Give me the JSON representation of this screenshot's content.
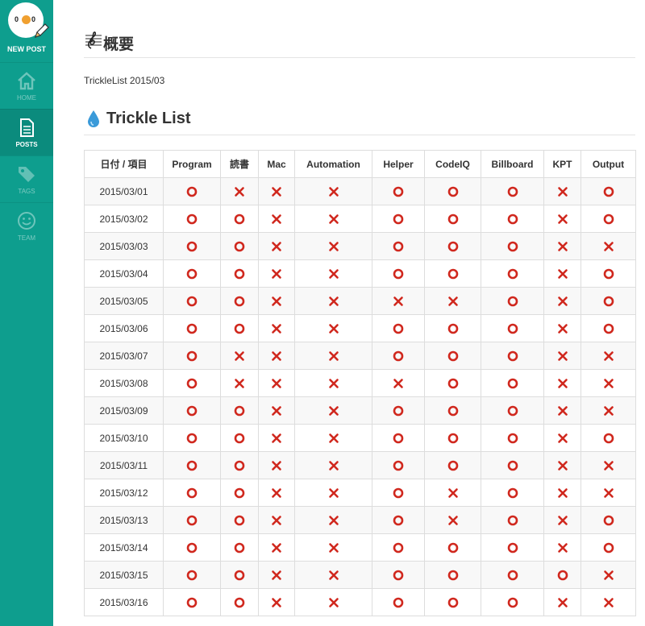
{
  "sidebar": {
    "new_post": "NEW POST",
    "items": [
      {
        "label": "HOME",
        "icon": "home-icon",
        "active": false
      },
      {
        "label": "POSTS",
        "icon": "document-icon",
        "active": true
      },
      {
        "label": "TAGS",
        "icon": "tag-icon",
        "active": false
      },
      {
        "label": "TEAM",
        "icon": "smiley-icon",
        "active": false
      }
    ],
    "avatar_eyes": [
      "0",
      "0"
    ]
  },
  "colors": {
    "sidebar_bg": "#0e9e8e",
    "sidebar_active": "#0b8b7d",
    "mark_red": "#d0281e",
    "drop_blue": "#3a9ad9"
  },
  "overview": {
    "heading": "概要",
    "subtitle": "TrickleList 2015/03"
  },
  "trickle": {
    "heading": "Trickle List",
    "columns": [
      "日付 / 項目",
      "Program",
      "読書",
      "Mac",
      "Automation",
      "Helper",
      "CodeIQ",
      "Billboard",
      "KPT",
      "Output"
    ],
    "rows": [
      {
        "date": "2015/03/01",
        "marks": [
          "o",
          "x",
          "x",
          "x",
          "o",
          "o",
          "o",
          "x",
          "o"
        ]
      },
      {
        "date": "2015/03/02",
        "marks": [
          "o",
          "o",
          "x",
          "x",
          "o",
          "o",
          "o",
          "x",
          "o"
        ]
      },
      {
        "date": "2015/03/03",
        "marks": [
          "o",
          "o",
          "x",
          "x",
          "o",
          "o",
          "o",
          "x",
          "x"
        ]
      },
      {
        "date": "2015/03/04",
        "marks": [
          "o",
          "o",
          "x",
          "x",
          "o",
          "o",
          "o",
          "x",
          "o"
        ]
      },
      {
        "date": "2015/03/05",
        "marks": [
          "o",
          "o",
          "x",
          "x",
          "x",
          "x",
          "o",
          "x",
          "o"
        ]
      },
      {
        "date": "2015/03/06",
        "marks": [
          "o",
          "o",
          "x",
          "x",
          "o",
          "o",
          "o",
          "x",
          "o"
        ]
      },
      {
        "date": "2015/03/07",
        "marks": [
          "o",
          "x",
          "x",
          "x",
          "o",
          "o",
          "o",
          "x",
          "x"
        ]
      },
      {
        "date": "2015/03/08",
        "marks": [
          "o",
          "x",
          "x",
          "x",
          "x",
          "o",
          "o",
          "x",
          "x"
        ]
      },
      {
        "date": "2015/03/09",
        "marks": [
          "o",
          "o",
          "x",
          "x",
          "o",
          "o",
          "o",
          "x",
          "x"
        ]
      },
      {
        "date": "2015/03/10",
        "marks": [
          "o",
          "o",
          "x",
          "x",
          "o",
          "o",
          "o",
          "x",
          "o"
        ]
      },
      {
        "date": "2015/03/11",
        "marks": [
          "o",
          "o",
          "x",
          "x",
          "o",
          "o",
          "o",
          "x",
          "x"
        ]
      },
      {
        "date": "2015/03/12",
        "marks": [
          "o",
          "o",
          "x",
          "x",
          "o",
          "x",
          "o",
          "x",
          "x"
        ]
      },
      {
        "date": "2015/03/13",
        "marks": [
          "o",
          "o",
          "x",
          "x",
          "o",
          "x",
          "o",
          "x",
          "o"
        ]
      },
      {
        "date": "2015/03/14",
        "marks": [
          "o",
          "o",
          "x",
          "x",
          "o",
          "o",
          "o",
          "x",
          "o"
        ]
      },
      {
        "date": "2015/03/15",
        "marks": [
          "o",
          "o",
          "x",
          "x",
          "o",
          "o",
          "o",
          "o",
          "x"
        ]
      },
      {
        "date": "2015/03/16",
        "marks": [
          "o",
          "o",
          "x",
          "x",
          "o",
          "o",
          "o",
          "x",
          "x"
        ]
      }
    ]
  }
}
